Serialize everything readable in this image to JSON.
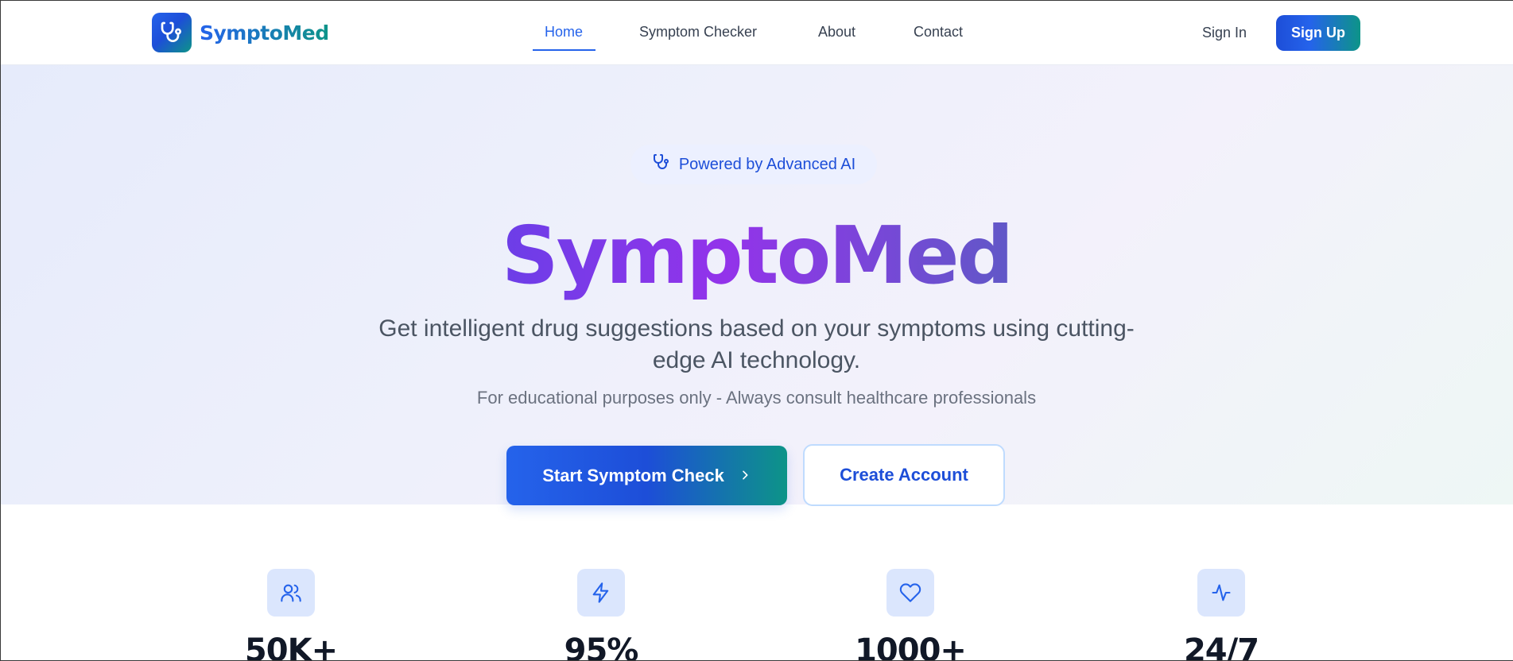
{
  "brand": {
    "name": "SymptoMed",
    "logo_icon": "stethoscope-icon"
  },
  "nav": {
    "links": [
      {
        "label": "Home",
        "active": true
      },
      {
        "label": "Symptom Checker",
        "active": false
      },
      {
        "label": "About",
        "active": false
      },
      {
        "label": "Contact",
        "active": false
      }
    ],
    "sign_in": "Sign In",
    "sign_up": "Sign Up"
  },
  "hero": {
    "badge": {
      "icon": "stethoscope-icon",
      "text": "Powered by Advanced AI"
    },
    "title_parts": [
      "Sympto",
      "Med"
    ],
    "subtitle": "Get intelligent drug suggestions based on your symptoms using cutting-edge AI technology.",
    "note": "For educational purposes only - Always consult healthcare professionals",
    "primary_button": {
      "label": "Start Symptom Check",
      "icon": "chevron-right-icon"
    },
    "secondary_button": {
      "label": "Create Account"
    }
  },
  "stats": [
    {
      "icon": "users-icon",
      "value": "50K+"
    },
    {
      "icon": "lightning-icon",
      "value": "95%"
    },
    {
      "icon": "heart-icon",
      "value": "1000+"
    },
    {
      "icon": "activity-icon",
      "value": "24/7"
    }
  ],
  "colors": {
    "accent": "#2563eb",
    "teal": "#0d9488",
    "purple": "#9333ea",
    "stat_icon_bg": "#dbe6fd"
  }
}
